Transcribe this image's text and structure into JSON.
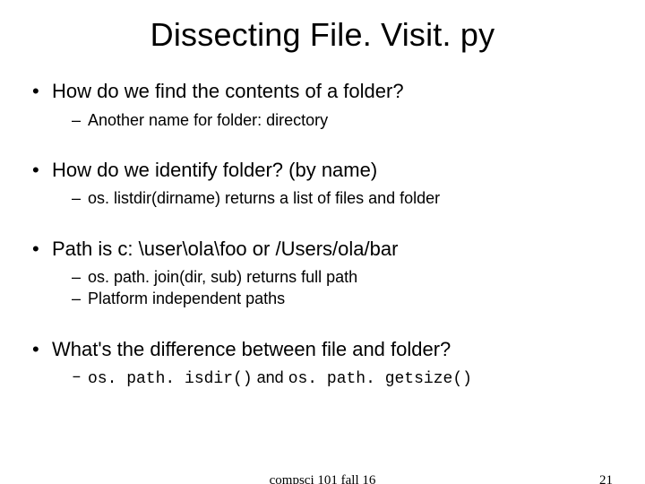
{
  "title": "Dissecting File. Visit. py",
  "bullets": [
    {
      "text": "How do we find the contents of a folder?",
      "sub": [
        {
          "text": "Another name for folder: directory"
        }
      ]
    },
    {
      "text": "How do we identify folder? (by name)",
      "sub": [
        {
          "text": "os. listdir(dirname) returns a list of files and folder"
        }
      ]
    },
    {
      "text": "Path is c: \\user\\ola\\foo or /Users/ola/bar",
      "sub": [
        {
          "text": "os. path. join(dir, sub) returns full path"
        },
        {
          "text": "Platform independent paths"
        }
      ]
    },
    {
      "text": "What's the difference between file and folder?",
      "sub": [
        {
          "prefix": "os. path. isdir()",
          "mid": " and ",
          "suffix": "os. path. getsize()",
          "mono": true
        }
      ]
    }
  ],
  "footer": {
    "center": "compsci 101 fall 16",
    "right": "21"
  }
}
